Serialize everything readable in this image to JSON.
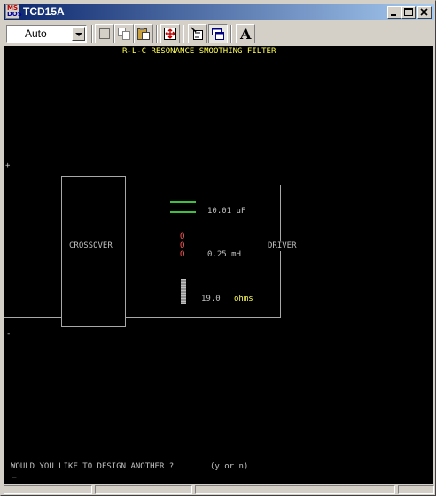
{
  "window": {
    "title": "TCD15A",
    "icon_top": "MS",
    "icon_bottom": "DOS",
    "controls": [
      "minimize-icon",
      "maximize-icon",
      "close-icon"
    ]
  },
  "toolbar": {
    "font_size_value": "Auto",
    "buttons": [
      "mark-icon",
      "copy-icon",
      "paste-icon",
      "fullscreen-icon",
      "properties-icon",
      "background-icon",
      "font-icon"
    ],
    "font_button_label": "A"
  },
  "screen": {
    "title": "R-L-C RESONANCE SMOOTHING FILTER",
    "plus_sign": "+",
    "minus_sign": "-",
    "crossover_label": "CROSSOVER",
    "driver_label": "DRIVER",
    "capacitor_value": "10.01 uF",
    "inductor_value": "0.25 mH",
    "inductor_coil": "O\nO\nO",
    "resistor_value": "19.0",
    "resistor_unit": "ohms",
    "prompt": "WOULD YOU LIKE TO DESIGN ANOTHER ?",
    "prompt_options": "(y or n)",
    "cursor": "_",
    "colors": {
      "background": "#000000",
      "text": "#c0c0c0",
      "title": "#ffff55",
      "capacitor": "#55ff55",
      "inductor": "#ff5555",
      "resistor_unit": "#ffff55",
      "wires": "#a8a8a8"
    }
  }
}
